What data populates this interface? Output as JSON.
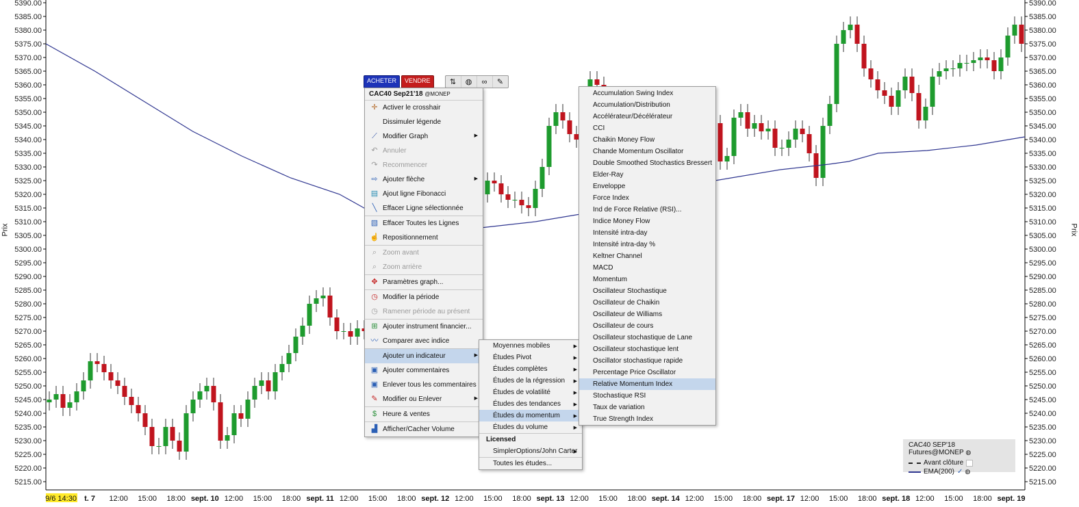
{
  "chart_data": {
    "type": "candlestick",
    "ylabel": "Prix",
    "ylim": [
      5212,
      5391
    ],
    "y_ticks": [
      5390,
      5385,
      5380,
      5375,
      5370,
      5365,
      5360,
      5355,
      5350,
      5345,
      5340,
      5335,
      5330,
      5325,
      5320,
      5315,
      5310,
      5305,
      5300,
      5295,
      5290,
      5285,
      5280,
      5275,
      5270,
      5265,
      5260,
      5255,
      5250,
      5245,
      5240,
      5235,
      5230,
      5225,
      5220,
      5215
    ],
    "x_ticks": [
      "9/6 14:30",
      "t. 7",
      "12:00",
      "15:00",
      "18:00",
      "sept. 10",
      "12:00",
      "15:00",
      "18:00",
      "sept. 11",
      "12:00",
      "15:00",
      "18:00",
      "sept. 12",
      "12:00",
      "15:00",
      "18:00",
      "sept. 13",
      "12:00",
      "15:00",
      "18:00",
      "sept. 14",
      "12:00",
      "15:00",
      "18:00",
      "sept. 17",
      "12:00",
      "15:00",
      "18:00",
      "sept. 18",
      "12:00",
      "15:00",
      "18:00",
      "sept. 19"
    ],
    "bold_ticks": [
      "t. 7",
      "sept. 10",
      "sept. 11",
      "sept. 12",
      "sept. 13",
      "sept. 14",
      "sept. 17",
      "sept. 18",
      "sept. 19"
    ],
    "series": [
      {
        "name": "CAC40 SEP'18 Futures@MONEP",
        "close": [
          5245,
          5247,
          5242,
          5244,
          5248,
          5252,
          5259,
          5258,
          5255,
          5252,
          5250,
          5246,
          5243,
          5240,
          5235,
          5228,
          5228,
          5235,
          5230,
          5226,
          5240,
          5245,
          5248,
          5250,
          5244,
          5230,
          5232,
          5240,
          5238,
          5245,
          5250,
          5252,
          5248,
          5255,
          5258,
          5262,
          5268,
          5272,
          5280,
          5282,
          5283,
          5275,
          5270,
          5270,
          5268,
          5271,
          5270,
          5273,
          5276,
          5275,
          5282,
          5283,
          5275,
          5264,
          5260,
          5255,
          5250,
          5252,
          5245,
          5242,
          5238,
          5240,
          5245,
          5320,
          5325,
          5324,
          5320,
          5318,
          5318,
          5316,
          5315,
          5322,
          5330,
          5345,
          5350,
          5347,
          5342,
          5340,
          5345,
          5362,
          5360,
          5355,
          5348,
          5347,
          5352,
          5345,
          5340,
          5337,
          5335,
          5342,
          5344,
          5348,
          5345,
          5336,
          5339,
          5346,
          5350,
          5346,
          5332,
          5334,
          5348,
          5350,
          5344,
          5346,
          5343,
          5344,
          5337,
          5337,
          5340,
          5344,
          5342,
          5335,
          5326,
          5345,
          5353,
          5375,
          5380,
          5382,
          5375,
          5366,
          5362,
          5358,
          5356,
          5352,
          5358,
          5363,
          5357,
          5347,
          5352,
          5363,
          5365,
          5366,
          5366,
          5368,
          5368,
          5369,
          5370,
          5369,
          5365,
          5370,
          5378,
          5382,
          5375
        ],
        "open": [
          5244,
          5245,
          5247,
          5242,
          5244,
          5248,
          5252,
          5259,
          5258,
          5255,
          5252,
          5250,
          5246,
          5243,
          5240,
          5235,
          5228,
          5228,
          5235,
          5230,
          5226,
          5240,
          5245,
          5248,
          5250,
          5244,
          5230,
          5232,
          5240,
          5238,
          5245,
          5250,
          5252,
          5248,
          5255,
          5258,
          5262,
          5268,
          5272,
          5280,
          5282,
          5283,
          5275,
          5270,
          5270,
          5268,
          5271,
          5270,
          5273,
          5276,
          5275,
          5282,
          5283,
          5275,
          5264,
          5260,
          5255,
          5250,
          5252,
          5245,
          5242,
          5238,
          5240,
          5310,
          5320,
          5325,
          5324,
          5320,
          5318,
          5318,
          5316,
          5315,
          5322,
          5330,
          5345,
          5350,
          5347,
          5342,
          5340,
          5345,
          5362,
          5360,
          5355,
          5348,
          5347,
          5352,
          5345,
          5340,
          5337,
          5335,
          5342,
          5344,
          5348,
          5345,
          5336,
          5339,
          5346,
          5350,
          5346,
          5332,
          5334,
          5348,
          5350,
          5344,
          5346,
          5343,
          5344,
          5337,
          5337,
          5340,
          5344,
          5342,
          5335,
          5326,
          5345,
          5353,
          5375,
          5380,
          5382,
          5375,
          5366,
          5362,
          5358,
          5356,
          5352,
          5358,
          5363,
          5357,
          5347,
          5352,
          5363,
          5365,
          5366,
          5366,
          5368,
          5368,
          5369,
          5370,
          5369,
          5365,
          5370,
          5378,
          5382
        ]
      }
    ],
    "ema200": [
      [
        0,
        5375
      ],
      [
        0.05,
        5365
      ],
      [
        0.1,
        5354
      ],
      [
        0.15,
        5343
      ],
      [
        0.2,
        5334
      ],
      [
        0.25,
        5326
      ],
      [
        0.3,
        5320
      ],
      [
        0.34,
        5312
      ],
      [
        0.4,
        5306
      ],
      [
        0.45,
        5308
      ],
      [
        0.5,
        5310
      ],
      [
        0.55,
        5313
      ],
      [
        0.6,
        5318
      ],
      [
        0.65,
        5323
      ],
      [
        0.7,
        5326
      ],
      [
        0.75,
        5329
      ],
      [
        0.8,
        5331
      ],
      [
        0.82,
        5332
      ],
      [
        0.85,
        5335
      ],
      [
        0.9,
        5336
      ],
      [
        0.95,
        5338
      ],
      [
        1.0,
        5341
      ]
    ]
  },
  "toolbar": {
    "buy_label": "ACHETER",
    "sell_label": "VENDRE"
  },
  "menu": {
    "header": "CAC40  Sep21'18",
    "header_exchange": "@MONEP",
    "items": [
      {
        "label": "Activer le crosshair"
      },
      {
        "label": "Dissimuler légende"
      },
      {
        "label": "Modifier Graph"
      },
      {
        "label": "Annuler"
      },
      {
        "label": "Recommencer"
      },
      {
        "label": "Ajouter flèche"
      },
      {
        "label": "Ajout ligne Fibonacci"
      },
      {
        "label": "Effacer Ligne sélectionnée"
      },
      {
        "label": "Effacer Toutes les Lignes"
      },
      {
        "label": "Repositionnement"
      },
      {
        "label": "Zoom avant"
      },
      {
        "label": "Zoom arrière"
      },
      {
        "label": "Paramètres graph..."
      },
      {
        "label": "Modifier la période"
      },
      {
        "label": "Ramener période au présent"
      },
      {
        "label": "Ajouter instrument financier..."
      },
      {
        "label": "Comparer avec indice"
      },
      {
        "label": "Ajouter un indicateur"
      },
      {
        "label": "Ajouter commentaires"
      },
      {
        "label": "Enlever tous les commentaires"
      },
      {
        "label": "Modifier ou Enlever"
      },
      {
        "label": "Heure & ventes"
      },
      {
        "label": "Afficher/Cacher Volume"
      }
    ]
  },
  "submenu": {
    "items": [
      {
        "label": "Moyennes mobiles"
      },
      {
        "label": "Études Pivot"
      },
      {
        "label": "Études complètes"
      },
      {
        "label": "Études de la régression"
      },
      {
        "label": "Études de volatilité"
      },
      {
        "label": "Études des tendances"
      },
      {
        "label": "Études du momentum"
      },
      {
        "label": "Études du volume"
      },
      {
        "label": "Licensed"
      },
      {
        "label": "SimplerOptions/John Carter"
      },
      {
        "label": "Toutes les études..."
      }
    ]
  },
  "indicators": [
    "Accumulation Swing Index",
    "Accumulation/Distribution",
    "Accélérateur/Décélérateur",
    "CCI",
    "Chaikin Money Flow",
    "Chande Momentum Oscillator",
    "Double Smoothed Stochastics Bressert",
    "Elder-Ray",
    "Enveloppe",
    "Force Index",
    "Ind de Force Relative (RSI)...",
    "Indice Money Flow",
    "Intensité intra-day",
    "Intensité intra-day %",
    "Keltner Channel",
    "MACD",
    "Momentum",
    "Oscillateur Stochastique",
    "Oscillateur de Chaikin",
    "Oscillateur de Williams",
    "Oscillateur de cours",
    "Oscillateur stochastique de Lane",
    "Oscillateur stochastique lent",
    "Oscillator stochastique rapide",
    "Percentage Price Oscillator",
    "Relative Momentum Index",
    "Stochastique RSI",
    "Taux de variation",
    "True Strength Index"
  ],
  "legend": {
    "title": "CAC40 SEP'18 Futures@MONEP",
    "avant": "Avant clôture",
    "ema": "EMA(200)"
  },
  "colors": {
    "up": "#1e9b2e",
    "down": "#c0141e",
    "ema": "#2f3690",
    "highlight": "#c4d6ec"
  }
}
